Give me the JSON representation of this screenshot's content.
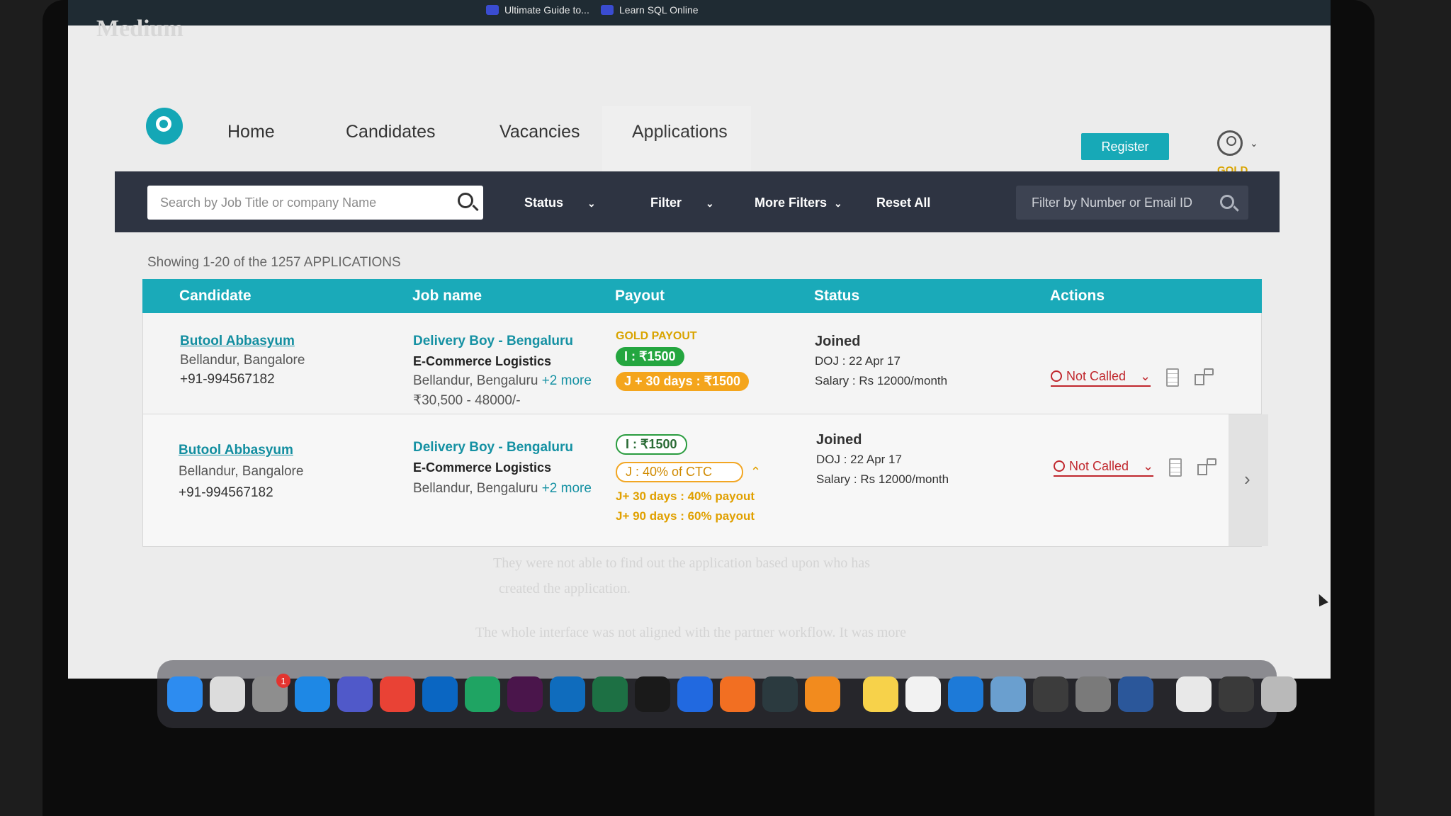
{
  "browser": {
    "tabs": [
      "Ultimate Guide to...",
      "Learn SQL Online"
    ],
    "ghost_title": "Medium"
  },
  "nav": {
    "items": [
      "Home",
      "Candidates",
      "Vacancies",
      "Applications"
    ],
    "active": "Applications",
    "register_label": "Register",
    "tier_label": "GOLD"
  },
  "filters": {
    "search_placeholder": "Search by Job Title or company Name",
    "status_label": "Status",
    "filter_label": "Filter",
    "more_filters_label": "More Filters",
    "reset_label": "Reset All",
    "number_placeholder": "Filter by Number or Email ID"
  },
  "summary": "Showing 1-20 of the 1257 APPLICATIONS",
  "table": {
    "headers": [
      "Candidate",
      "Job name",
      "Payout",
      "Status",
      "Actions"
    ],
    "rows": [
      {
        "name": "Butool Abbasyum",
        "location": "Bellandur, Bangalore",
        "phone": "+91-994567182",
        "job_title": "Delivery Boy - Bengaluru",
        "company": "E-Commerce Logistics",
        "job_location": "Bellandur, Bengaluru",
        "more": "+2 more",
        "salary_range": "₹30,500 - 48000/-",
        "payout_label": "GOLD PAYOUT",
        "payout_i": "I : ₹1500",
        "payout_j": "J + 30 days : ₹1500",
        "status": "Joined",
        "doj": "DOJ : 22 Apr 17",
        "salary": "Salary : Rs 12000/month",
        "call_status": "Not Called"
      },
      {
        "name": "Butool Abbasyum",
        "location": "Bellandur, Bangalore",
        "phone": "+91-994567182",
        "job_title": "Delivery Boy - Bengaluru",
        "company": "E-Commerce Logistics",
        "job_location": "Bellandur, Bengaluru",
        "more": "+2 more",
        "payout_i": "I : ₹1500",
        "payout_j": "J : 40% of CTC",
        "note1": "J+ 30 days : 40% payout",
        "note2": "J+ 90 days : 60% payout",
        "status": "Joined",
        "doj": "DOJ : 22 Apr 17",
        "salary": "Salary : Rs 12000/month",
        "call_status": "Not Called"
      }
    ]
  },
  "background_notes": [
    "They were not able to find out the application based upon who has",
    "created the application.",
    "The whole interface was not aligned with the partner workflow. It was more"
  ],
  "dock": {
    "icons": [
      "finder-icon",
      "launchpad-icon",
      "system-settings-icon",
      "app-store-icon",
      "teams-icon",
      "chrome-icon",
      "vscode-icon",
      "pycharm-icon",
      "slack-icon",
      "outlook-icon",
      "excel-icon",
      "terminal-icon",
      "maps-pin-icon",
      "pen-icon",
      "arrow-app-icon",
      "vpn-icon",
      "notes-icon",
      "textedit-icon",
      "docker-icon",
      "preview-icon",
      "box-icon",
      "sequel-icon",
      "word-icon",
      "document-icon",
      "scanner-icon",
      "trash-icon"
    ],
    "settings_badge": "1",
    "colors": [
      "#2d8cf0",
      "#dcdcdc",
      "#8e8e8e",
      "#1e88e5",
      "#5059c9",
      "#e94235",
      "#0a66c2",
      "#1fa463",
      "#4a154b",
      "#0f6cbd",
      "#1d7044",
      "#1a1a1a",
      "#2169e0",
      "#f26f22",
      "#2b3a3f",
      "#f28b1e",
      "#f7d24a",
      "#f2f2f2",
      "#1d7ad8",
      "#6a9fcf",
      "#3c3c3c",
      "#7a7a7a",
      "#2b579a",
      "#e8e8e8",
      "#3a3a3a",
      "#b9b9b9"
    ]
  }
}
